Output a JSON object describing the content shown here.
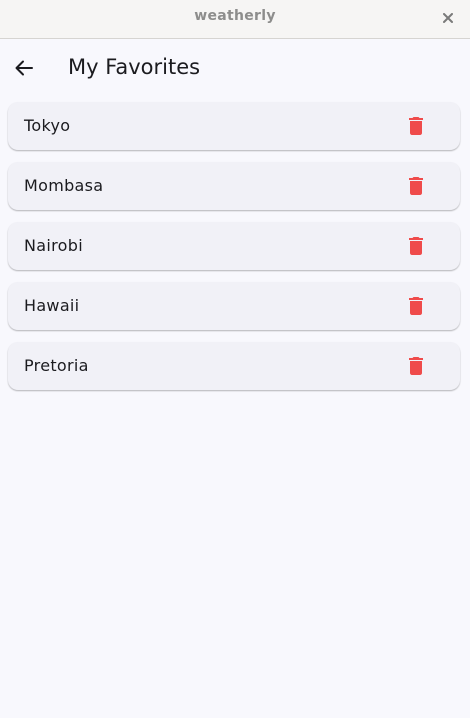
{
  "window": {
    "title": "weatherly",
    "close_icon": "close-icon"
  },
  "appbar": {
    "back_icon": "arrow-back-icon",
    "title": "My Favorites"
  },
  "favorites": [
    {
      "name": "Tokyo",
      "action_icon": "trash-icon"
    },
    {
      "name": "Mombasa",
      "action_icon": "trash-icon"
    },
    {
      "name": "Nairobi",
      "action_icon": "trash-icon"
    },
    {
      "name": "Hawaii",
      "action_icon": "trash-icon"
    },
    {
      "name": "Pretoria",
      "action_icon": "trash-icon"
    }
  ],
  "colors": {
    "background": "#f8f8fd",
    "card": "#f1f1f7",
    "delete": "#ef4b4b",
    "text": "#1b1b1f"
  }
}
